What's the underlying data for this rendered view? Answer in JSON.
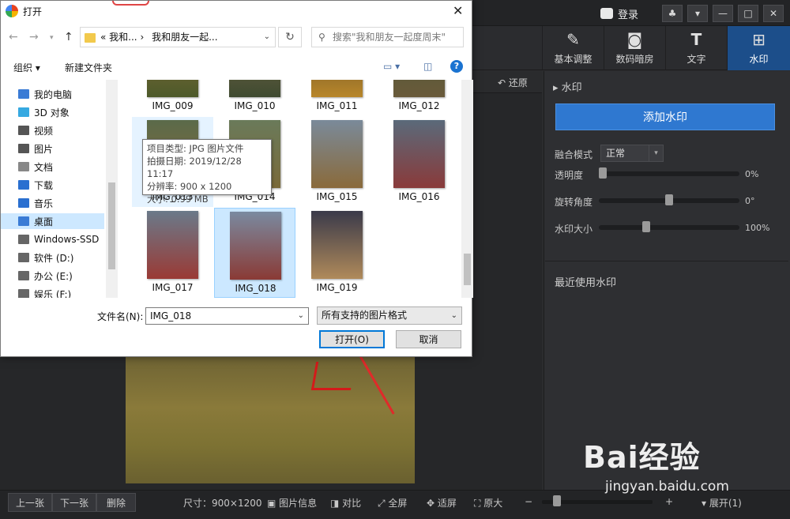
{
  "app": {
    "login_label": "登录",
    "tools": [
      {
        "label": "基本调整",
        "icon": "edit-icon"
      },
      {
        "label": "数码暗房",
        "icon": "camera-icon"
      },
      {
        "label": "文字",
        "icon": "text-icon"
      },
      {
        "label": "水印",
        "icon": "watermark-icon",
        "active": true
      }
    ],
    "restore_label": "还原",
    "panel": {
      "title": "水印",
      "add_button": "添加水印",
      "blend_label": "融合模式",
      "blend_value": "正常",
      "opacity_label": "透明度",
      "opacity_value": "0%",
      "opacity_level": 0,
      "rotation_label": "旋转角度",
      "rotation_value": "0°",
      "rotation_level": 0.5,
      "size_label": "水印大小",
      "size_value": "100%",
      "size_level": 0.33,
      "recent_label": "最近使用水印"
    },
    "statusbar": {
      "prev": "上一张",
      "next": "下一张",
      "delete": "删除",
      "size_text": "尺寸：900×1200",
      "info": "图片信息",
      "compare": "对比",
      "fullscreen": "全屏",
      "fit": "适屏",
      "original": "原大",
      "expand": "展开(1)"
    },
    "watermark_brand": "Bai经验",
    "watermark_url": "jingyan.baidu.com"
  },
  "dialog": {
    "title": "打开",
    "breadcrumb": [
      "我和...",
      "我和朋友一起..."
    ],
    "breadcrumb_prefix": "«",
    "search_placeholder": "搜索\"我和朋友一起度周末\"",
    "organize": "组织 ▾",
    "new_folder": "新建文件夹",
    "tree": [
      {
        "label": "我的电脑",
        "icon": "computer-icon",
        "color": "#3a7bd5"
      },
      {
        "label": "3D 对象",
        "icon": "cube-icon",
        "color": "#36a9e1"
      },
      {
        "label": "视频",
        "icon": "video-icon",
        "color": "#555"
      },
      {
        "label": "图片",
        "icon": "picture-icon",
        "color": "#555"
      },
      {
        "label": "文档",
        "icon": "document-icon",
        "color": "#888"
      },
      {
        "label": "下载",
        "icon": "download-icon",
        "color": "#2a6fd0"
      },
      {
        "label": "音乐",
        "icon": "music-icon",
        "color": "#2a6fd0"
      },
      {
        "label": "桌面",
        "icon": "desktop-icon",
        "color": "#3a7bd5",
        "selected": true
      },
      {
        "label": "Windows-SSD",
        "icon": "drive-icon",
        "color": "#666"
      },
      {
        "label": "软件 (D:)",
        "icon": "drive-icon",
        "color": "#666"
      },
      {
        "label": "办公 (E:)",
        "icon": "drive-icon",
        "color": "#666"
      },
      {
        "label": "娱乐 (F:)",
        "icon": "drive-icon",
        "color": "#666"
      }
    ],
    "files": [
      {
        "name": "IMG_009",
        "c1": "#8a6b3a",
        "c2": "#4d5a2a"
      },
      {
        "name": "IMG_010",
        "c1": "#7a6a4a",
        "c2": "#3f4a30"
      },
      {
        "name": "IMG_011",
        "c1": "#5a4a2a",
        "c2": "#b8862a"
      },
      {
        "name": "IMG_012",
        "c1": "#4a5a3a",
        "c2": "#6a5a3a"
      },
      {
        "name": "IMG_013",
        "c1": "#5a6a4a",
        "c2": "#8a6a3a",
        "state": "hover"
      },
      {
        "name": "IMG_014",
        "c1": "#6a7a5a",
        "c2": "#7a6a3a"
      },
      {
        "name": "IMG_015",
        "c1": "#7a8a9a",
        "c2": "#8a6a3a"
      },
      {
        "name": "IMG_016",
        "c1": "#5a6a7a",
        "c2": "#8a3a3a"
      },
      {
        "name": "IMG_017",
        "c1": "#6a7a8a",
        "c2": "#9a3a35"
      },
      {
        "name": "IMG_018",
        "c1": "#7a8aa0",
        "c2": "#8a3a35",
        "state": "selected"
      },
      {
        "name": "IMG_019",
        "c1": "#3a3a4a",
        "c2": "#b08a5a"
      }
    ],
    "tooltip": [
      "项目类型: JPG 图片文件",
      "拍摄日期: 2019/12/28 11:17",
      "分辨率: 900 x 1200",
      "大小: 0.99 MB"
    ],
    "filename_label": "文件名(N):",
    "filename_value": "IMG_018",
    "filetype_value": "所有支持的图片格式",
    "open_button": "打开(O)",
    "cancel_button": "取消"
  }
}
